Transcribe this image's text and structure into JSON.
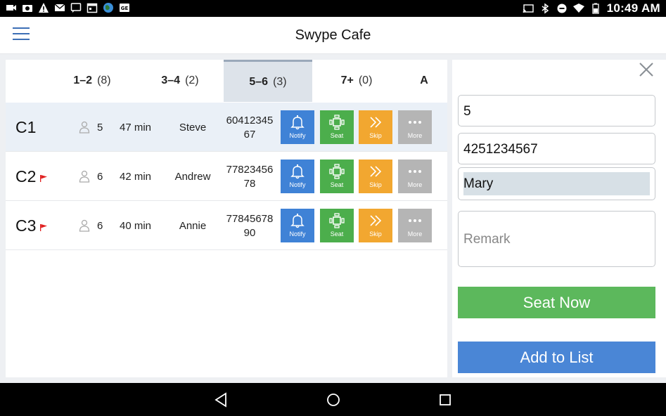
{
  "status_bar": {
    "time": "10:49 AM",
    "left_icons": [
      "video-icon",
      "camera-icon",
      "warning-icon",
      "mail-icon",
      "chat-icon",
      "calendar-icon",
      "globe-icon",
      "ge-icon"
    ],
    "right_icons": [
      "cast-icon",
      "bluetooth-icon",
      "dnd-icon",
      "wifi-icon",
      "battery-icon"
    ]
  },
  "header": {
    "title": "Swype Cafe",
    "menu_icon": "hamburger-menu-icon"
  },
  "tabs": [
    {
      "label": "1–2",
      "count": "(8)",
      "active": false
    },
    {
      "label": "3–4",
      "count": "(2)",
      "active": false
    },
    {
      "label": "5–6",
      "count": "(3)",
      "active": true
    },
    {
      "label": "7+",
      "count": "(0)",
      "active": false
    },
    {
      "label": "A",
      "count": "",
      "active": false
    }
  ],
  "actions": {
    "notify": "Notify",
    "seat": "Seat",
    "skip": "Skip",
    "more": "More"
  },
  "queue": [
    {
      "code": "C1",
      "flag": false,
      "size": "5",
      "wait": "47 min",
      "name": "Steve",
      "phone": "6041234567",
      "selected": true
    },
    {
      "code": "C2",
      "flag": true,
      "size": "6",
      "wait": "42 min",
      "name": "Andrew",
      "phone": "7782345678",
      "selected": false
    },
    {
      "code": "C3",
      "flag": true,
      "size": "6",
      "wait": "40 min",
      "name": "Annie",
      "phone": "7784567890",
      "selected": false
    }
  ],
  "form": {
    "party_size": "5",
    "phone": "4251234567",
    "name": "Mary",
    "remark_placeholder": "Remark",
    "seat_now": "Seat Now",
    "add_to_list": "Add to List"
  },
  "colors": {
    "notify": "#3f82d6",
    "seat": "#4cae4c",
    "skip": "#f2a730",
    "more": "#b5b5b5",
    "seat_now": "#5cb85c",
    "add_to_list": "#4a86d6",
    "flag": "#e02020"
  }
}
